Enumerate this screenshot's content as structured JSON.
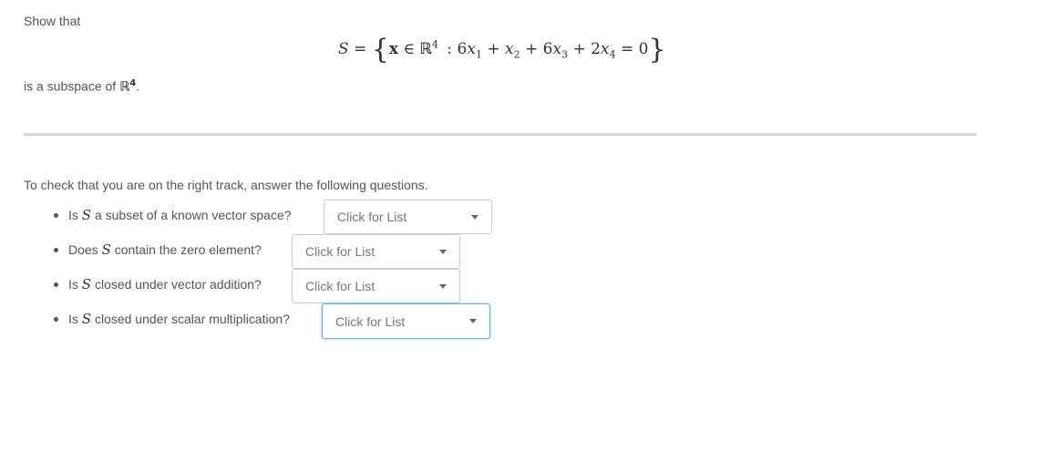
{
  "intro": {
    "show_that": "Show that",
    "is_subspace_prefix": "is a subspace of ",
    "space_symbol": "ℝ",
    "space_dim": "4",
    "period": "."
  },
  "equation": {
    "lhs": "S",
    "equals": "=",
    "open_brace": "{",
    "vector": "x",
    "in": "∈",
    "space_symbol": "ℝ",
    "space_dim": "4",
    "colon": ":",
    "terms": [
      {
        "coef": "6",
        "var": "x",
        "sub": "1",
        "op": "+"
      },
      {
        "coef": "",
        "var": "x",
        "sub": "2",
        "op": "+"
      },
      {
        "coef": "6",
        "var": "x",
        "sub": "3",
        "op": "+"
      },
      {
        "coef": "2",
        "var": "x",
        "sub": "4",
        "op": "="
      }
    ],
    "rhs": "0",
    "close_brace": "}"
  },
  "instructions": "To check that you are on the right track, answer the following questions.",
  "questions": [
    {
      "prefix": "Is ",
      "symbol": "S",
      "suffix": " a subset of a known vector space?",
      "dropdown": "Click for List"
    },
    {
      "prefix": "Does ",
      "symbol": "S",
      "suffix": " contain the zero element?",
      "dropdown": "Click for List"
    },
    {
      "prefix": "Is ",
      "symbol": "S",
      "suffix": " closed under vector addition?",
      "dropdown": "Click for List"
    },
    {
      "prefix": "Is ",
      "symbol": "S",
      "suffix": " closed under scalar multiplication?",
      "dropdown": "Click for List"
    }
  ],
  "colors": {
    "text": "#555555",
    "divider": "#d6d6d6",
    "dropdown_border": "#cccccc",
    "focus_border": "#66afe9"
  }
}
